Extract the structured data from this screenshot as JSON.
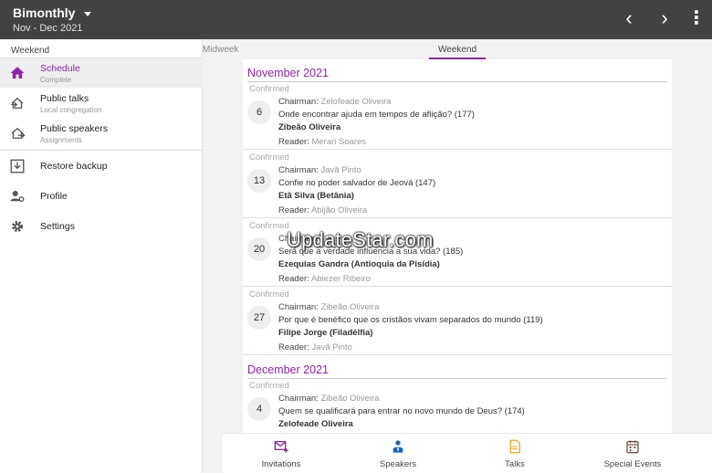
{
  "app_bar": {
    "title": "Bimonthly",
    "subtitle": "Nov - Dec 2021",
    "icons": {
      "dropdown": "caret-down",
      "prev": "chevron-left",
      "next": "chevron-right",
      "more": "more-vert"
    }
  },
  "sidebar": {
    "section_label": "Weekend",
    "items": [
      {
        "label": "Schedule",
        "sub": "Complete",
        "icon": "home-icon",
        "active": true
      },
      {
        "label": "Public talks",
        "sub": "Local congregation",
        "icon": "login-icon"
      },
      {
        "label": "Public speakers",
        "sub": "Assignments",
        "icon": "logout-icon"
      },
      {
        "label": "Restore backup",
        "icon": "download-icon"
      },
      {
        "label": "Profile",
        "icon": "person-settings-icon"
      },
      {
        "label": "Settings",
        "icon": "gear-icon"
      }
    ]
  },
  "tabs": [
    {
      "label": "Midweek",
      "active": false
    },
    {
      "label": "Weekend",
      "active": true
    }
  ],
  "months": [
    {
      "name": "November 2021",
      "meetings": [
        {
          "status": "Confirmed",
          "day": "6",
          "chairman_label": "Chairman:",
          "chairman": "Zelofeade Oliveira",
          "talk": "Onde encontrar ajuda em tempos de aflição? (177)",
          "speaker": "Zibeão Oliveira",
          "reader_label": "Reader:",
          "reader": "Merari Soares"
        },
        {
          "status": "Confirmed",
          "day": "13",
          "chairman_label": "Chairman:",
          "chairman": "Javã Pinto",
          "talk": "Confie no poder salvador de Jeová (147)",
          "speaker": "Etã Silva (Betânia)",
          "reader_label": "Reader:",
          "reader": "Abijão Oliveira"
        },
        {
          "status": "Confirmed",
          "day": "20",
          "chairman_label": "Chairman:",
          "chairman": "",
          "talk": "Será que a verdade influencia a sua vida? (185)",
          "speaker": "Ezequias Gandra (Antioquia da Pisídia)",
          "reader_label": "Reader:",
          "reader": "Abiezer Ribeiro"
        },
        {
          "status": "Confirmed",
          "day": "27",
          "chairman_label": "Chairman:",
          "chairman": "Zibeão Oliveira",
          "talk": "Por que é benéfico que os cristãos vivam separados do mundo (119)",
          "speaker": "Filipe Jorge (Filadélfia)",
          "reader_label": "Reader:",
          "reader": "Javã Pinto"
        }
      ]
    },
    {
      "name": "December 2021",
      "meetings": [
        {
          "status": "Confirmed",
          "day": "4",
          "chairman_label": "Chairman:",
          "chairman": "Zibeão Oliveira",
          "talk": "Quem se qualificará para entrar no novo mundo de Deus? (174)",
          "speaker": "Zelofeade Oliveira"
        }
      ]
    }
  ],
  "bottom_nav": [
    {
      "label": "Invitations",
      "icon": "mail-plus-icon",
      "color": "#8e24aa"
    },
    {
      "label": "Speakers",
      "icon": "speaker-person-icon",
      "color": "#1565c0"
    },
    {
      "label": "Talks",
      "icon": "document-icon",
      "color": "#f9a825"
    },
    {
      "label": "Special Events",
      "icon": "calendar-icon",
      "color": "#795548"
    }
  ],
  "watermark": "UpdateStar.com",
  "colors": {
    "accent": "#8e24aa",
    "appbar": "#424242"
  }
}
